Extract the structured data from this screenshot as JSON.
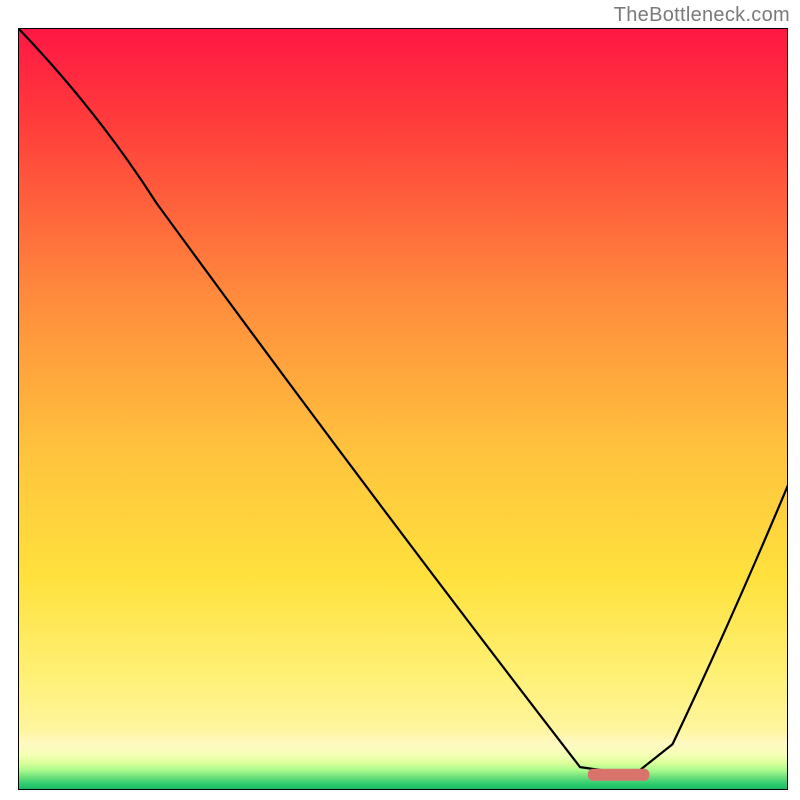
{
  "watermark": "TheBottleneck.com",
  "chart_data": {
    "type": "line",
    "title": "",
    "xlabel": "",
    "ylabel": "",
    "ylim": [
      0,
      100
    ],
    "xlim": [
      0,
      100
    ],
    "series": [
      {
        "name": "bottleneck-curve",
        "x": [
          0,
          18,
          73,
          80,
          85,
          100
        ],
        "values": [
          100,
          77,
          3,
          2,
          6,
          40
        ]
      }
    ],
    "optimal_marker": {
      "x_start": 74,
      "x_end": 82,
      "y": 2,
      "color": "#d9746c"
    },
    "gradient_stops": [
      {
        "pct": 0,
        "color": "#ff1744"
      },
      {
        "pct": 12,
        "color": "#ff3b3b"
      },
      {
        "pct": 35,
        "color": "#ff8a3d"
      },
      {
        "pct": 55,
        "color": "#ffc23d"
      },
      {
        "pct": 72,
        "color": "#ffe13d"
      },
      {
        "pct": 85,
        "color": "#fff176"
      },
      {
        "pct": 92,
        "color": "#fff59d"
      },
      {
        "pct": 94,
        "color": "#fff9c4"
      },
      {
        "pct": 95.5,
        "color": "#f4ffb3"
      },
      {
        "pct": 96.5,
        "color": "#d9ff99"
      },
      {
        "pct": 97.5,
        "color": "#a5f98c"
      },
      {
        "pct": 98.3,
        "color": "#6ee07a"
      },
      {
        "pct": 99.2,
        "color": "#2ecc71"
      },
      {
        "pct": 100,
        "color": "#18b85f"
      }
    ],
    "axes": {
      "show_frame": true,
      "frame_color": "#000000",
      "frame_width": 2
    }
  }
}
